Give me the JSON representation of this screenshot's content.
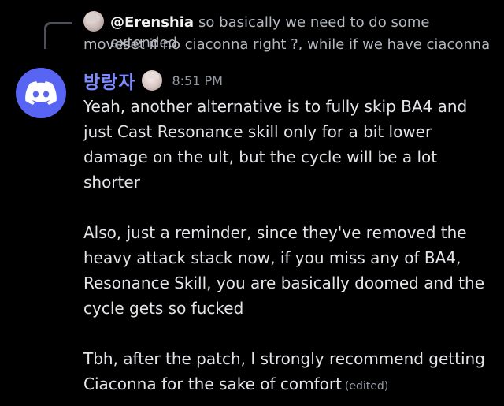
{
  "reply": {
    "mention": "@Erenshia",
    "text_line1": "so basically we need to do some extended",
    "text_line2": "moveset if no ciaconna right ?, while if we have ciaconna"
  },
  "message": {
    "username": "방랑자",
    "timestamp": "8:51 PM",
    "username_color": "#7b8aff",
    "avatar_color": "#5865f2",
    "avatar_icon": "discord-logo-icon",
    "lines": [
      "Yeah, another alternative is to fully skip BA4 and",
      "just Cast Resonance skill only for a bit lower",
      "damage on the ult, but the cycle will be a lot",
      "shorter",
      "",
      "Also, just a reminder, since they've removed the",
      "heavy attack stack now, if you miss  any of BA4,",
      "Resonance Skill, you are basically doomed and the",
      "cycle gets so fucked",
      "",
      "Tbh, after the patch, I strongly recommend getting",
      "Ciaconna for the sake of comfort"
    ],
    "edited_label": "(edited)"
  }
}
